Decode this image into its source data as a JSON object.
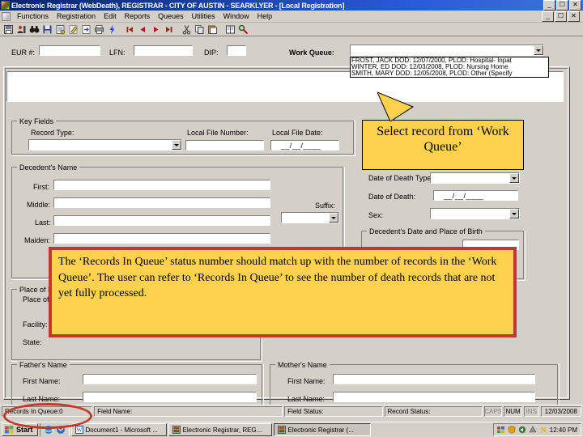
{
  "window": {
    "title": "Electronic Registrar (WebDeath), REGISTRAR - CITY OF AUSTIN - SEARKLYER - [Local Registration]",
    "minimize": "_",
    "maximize": "☐",
    "close": "✕",
    "child_minimize": "_",
    "child_maximize": "☐",
    "child_close": "✕"
  },
  "menu": {
    "items": [
      {
        "label": "Functions"
      },
      {
        "label": "Registration"
      },
      {
        "label": "Edit"
      },
      {
        "label": "Reports"
      },
      {
        "label": "Queues"
      },
      {
        "label": "Utilities"
      },
      {
        "label": "Window"
      },
      {
        "label": "Help"
      }
    ]
  },
  "toolbar": {
    "buttons": [
      {
        "name": "save-record-icon"
      },
      {
        "name": "person-record-icon"
      },
      {
        "name": "binoculars-search-icon"
      },
      {
        "name": "save-disk-icon"
      },
      {
        "name": "certify-icon"
      },
      {
        "name": "edit-pencil-icon"
      },
      {
        "name": "import-icon"
      },
      {
        "name": "print-icon"
      },
      {
        "name": "lightning-icon"
      },
      {
        "name": "first-record-icon"
      },
      {
        "name": "previous-record-icon"
      },
      {
        "name": "next-record-icon"
      },
      {
        "name": "last-record-icon"
      },
      {
        "name": "cut-icon"
      },
      {
        "name": "copy-icon"
      },
      {
        "name": "paste-icon"
      },
      {
        "name": "book-icon"
      },
      {
        "name": "tools-icon"
      }
    ]
  },
  "header_fields": {
    "eur_label": "EUR #:",
    "eur_value": "",
    "lfn_label": "LFN:",
    "lfn_value": "",
    "dip_label": "DIP:",
    "dip_value": "",
    "work_queue_label": "Work Queue:",
    "work_queue_value": "",
    "work_queue_options": [
      "FROST, JACK  DOD: 12/07/2000, PLOD: Hospital- Inpat",
      "WINTER, ED  DOD: 12/03/2008, PLOD: Nursing Home",
      "SMITH, MARY  DOD: 12/05/2008, PLOD: Other (Specify"
    ]
  },
  "key_fields": {
    "group_title": "Key Fields",
    "record_type_label": "Record Type:",
    "record_type_value": "",
    "local_file_number_label": "Local File Number:",
    "local_file_number_value": "",
    "local_file_date_label": "Local File Date:",
    "local_file_date_value": "__/__/____"
  },
  "decedent_name": {
    "group_title": "Decedent's Name",
    "first_label": "First:",
    "first_value": "",
    "middle_label": "Middle:",
    "middle_value": "",
    "last_label": "Last:",
    "last_value": "",
    "maiden_label": "Maiden:",
    "maiden_value": "",
    "suffix_label": "Suffix:",
    "suffix_value": ""
  },
  "place_of_death": {
    "group_title": "Place of Death",
    "place_label": "Place of Death Occurrence:",
    "place_value": "",
    "facility_label": "Facility:",
    "facility_value": "",
    "state_label": "State:",
    "state_value": ""
  },
  "fathers_name": {
    "group_title": "Father's Name",
    "first_label": "First Name:",
    "first_value": "",
    "last_label": "Last Name:",
    "last_value": ""
  },
  "mothers_name": {
    "group_title": "Mother's Name",
    "first_label": "First Name:",
    "first_value": "",
    "last_label": "Last Name:",
    "last_value": ""
  },
  "death_info": {
    "dod_type_label": "Date of Death Type:",
    "dod_type_value": "",
    "dod_label": "Date of Death:",
    "dod_value": "__/__/____",
    "sex_label": "Sex:",
    "sex_value": ""
  },
  "birth_info": {
    "group_title": "Decedent's Date and Place of Birth",
    "dob_value": ""
  },
  "callouts": {
    "small": "Select record from ‘Work Queue’",
    "big": "The ‘Records In Queue’ status number should match up with the number of records in the ‘Work Queue’.  The user can refer to ‘Records In Queue’ to see the number of death records that are not yet fully processed."
  },
  "statusbar": {
    "records_in_queue": "Records In Queue:0",
    "field_name": "Field Name:",
    "field_status": "Field Status:",
    "record_status": "Record Status:",
    "caps": "CAPS",
    "num": "NUM",
    "ins": "INS",
    "date": "12/03/2008"
  },
  "taskbar": {
    "start": "Start",
    "buttons": [
      {
        "label": "Document1 - Microsoft ...",
        "icon": "word-icon"
      },
      {
        "label": "Electronic Registrar, REG...",
        "icon": "registrar-icon"
      },
      {
        "label": "Electronic Registrar (...",
        "icon": "registrar-icon"
      }
    ],
    "time": "12:40 PM"
  },
  "colors": {
    "callout_fill": "#ffd24d",
    "callout_border": "#c0392b",
    "title_blue": "#0a246a",
    "face": "#d4d0c8"
  }
}
